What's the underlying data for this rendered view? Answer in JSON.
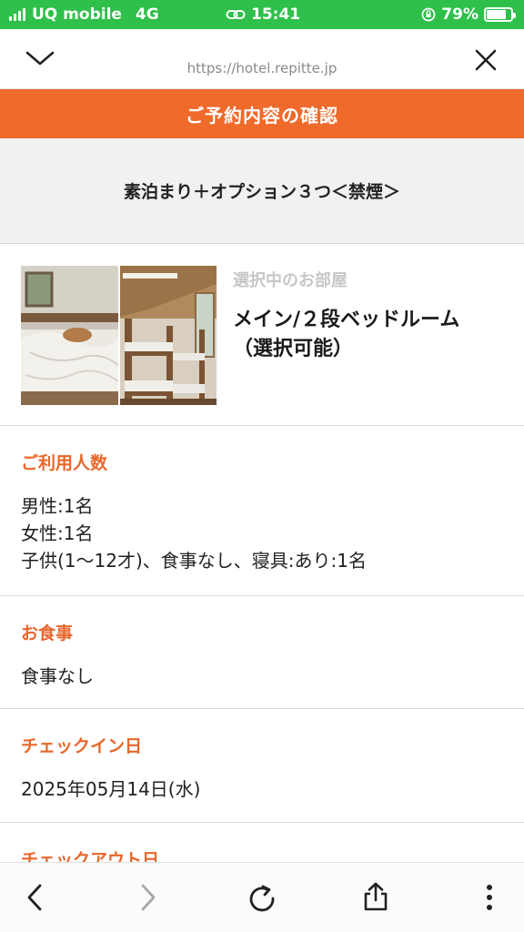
{
  "status_bar": {
    "carrier": "UQ mobile",
    "network": "4G",
    "time": "15:41",
    "battery_percent": "79%",
    "battery_level": 0.79,
    "bg_color": "#2ec04a"
  },
  "browser": {
    "url": "https://hotel.repitte.jp",
    "collapse_icon": "chevron-down-icon",
    "close_icon": "close-icon"
  },
  "header": {
    "title": "ご予約内容の確認",
    "accent_color": "#ef6a2b"
  },
  "plan": {
    "name": "素泊まり＋オプション３つ＜禁煙＞"
  },
  "room": {
    "label": "選択中のお部屋",
    "name_line1": "メイン/２段ベッドルーム",
    "name_line2": "（選択可能）"
  },
  "guests": {
    "title": "ご利用人数",
    "lines": [
      "男性:1名",
      "女性:1名",
      "子供(1〜12才)、食事なし、寝具:あり:1名"
    ]
  },
  "meal": {
    "title": "お食事",
    "value": "食事なし"
  },
  "checkin": {
    "title": "チェックイン日",
    "value": "2025年05月14日(水)"
  },
  "checkout": {
    "title": "チェックアウト日"
  },
  "toolbar": {
    "icons": [
      "back-icon",
      "forward-icon",
      "reload-icon",
      "share-icon",
      "more-icon"
    ]
  }
}
